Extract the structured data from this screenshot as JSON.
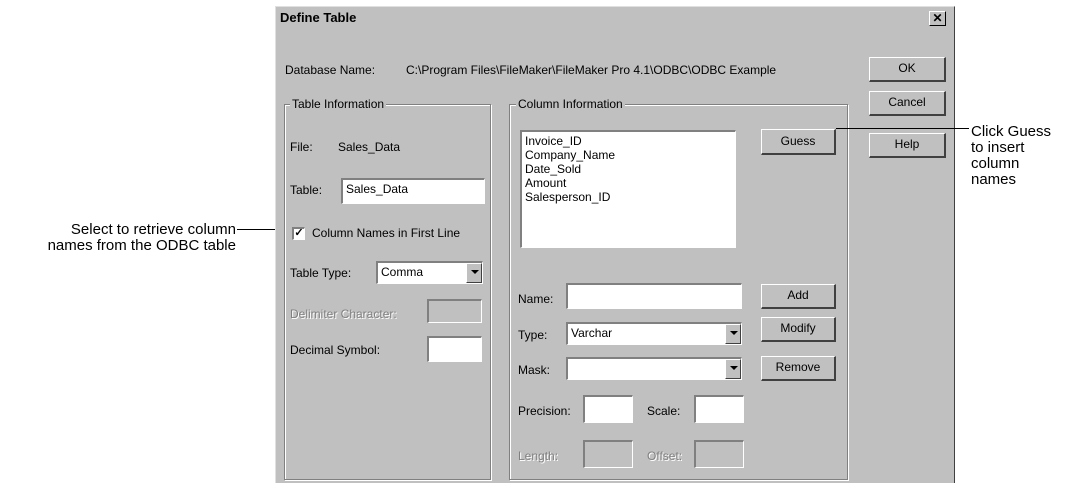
{
  "callouts": {
    "left_line1": "Select to retrieve column",
    "left_line2": "names from the ODBC table",
    "right_line1": "Click Guess",
    "right_line2": "to insert",
    "right_line3": "column",
    "right_line4": "names"
  },
  "dialog": {
    "title": "Define Table",
    "close_glyph": "✕",
    "database_label": "Database Name:",
    "database_value": "C:\\Program Files\\FileMaker\\FileMaker Pro 4.1\\ODBC\\ODBC Example",
    "ok_label": "OK",
    "cancel_label": "Cancel",
    "help_label": "Help"
  },
  "table_info": {
    "group_label": "Table Information",
    "file_label": "File:",
    "file_value": "Sales_Data",
    "table_label": "Table:",
    "table_value": "Sales_Data",
    "column_names_label": "Column Names in First Line",
    "column_names_checked": true,
    "check_glyph": "✓",
    "table_type_label": "Table Type:",
    "table_type_value": "Comma",
    "delimiter_label": "Delimiter Character:",
    "delimiter_value": "",
    "decimal_label": "Decimal Symbol:",
    "decimal_value": ""
  },
  "column_info": {
    "group_label": "Column Information",
    "columns": [
      "Invoice_ID",
      "Company_Name",
      "Date_Sold",
      "Amount",
      "Salesperson_ID"
    ],
    "guess_label": "Guess",
    "name_label": "Name:",
    "name_value": "",
    "add_label": "Add",
    "type_label": "Type:",
    "type_value": "Varchar",
    "modify_label": "Modify",
    "mask_label": "Mask:",
    "mask_value": "",
    "remove_label": "Remove",
    "precision_label": "Precision:",
    "precision_value": "",
    "scale_label": "Scale:",
    "scale_value": "",
    "length_label": "Length:",
    "length_value": "",
    "offset_label": "Offset:",
    "offset_value": ""
  }
}
